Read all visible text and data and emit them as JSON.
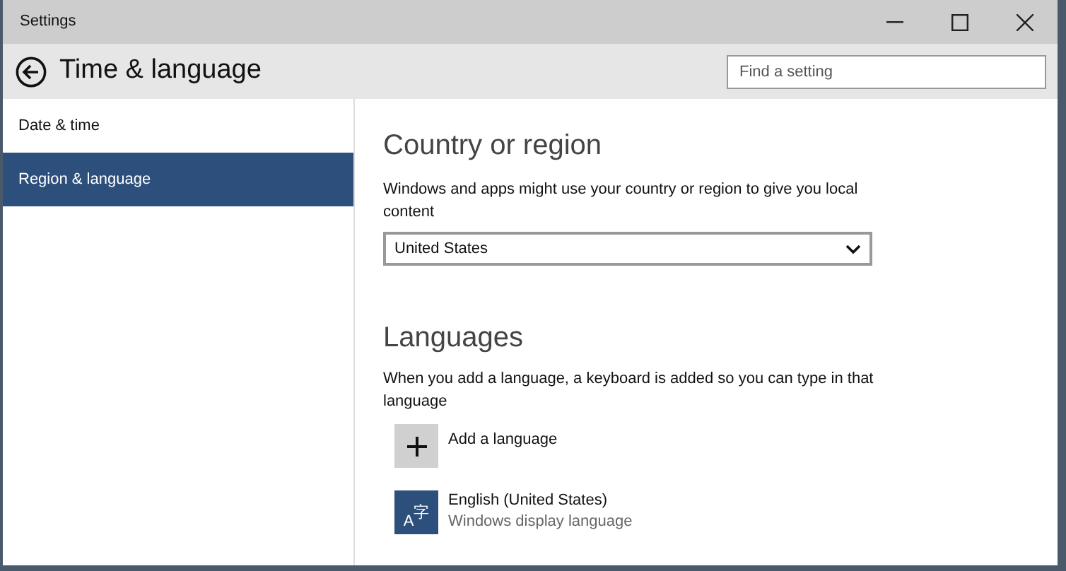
{
  "window": {
    "title": "Settings"
  },
  "header": {
    "title": "Time & language",
    "search": {
      "placeholder": "Find a setting"
    }
  },
  "sidebar": {
    "items": [
      {
        "label": "Date & time",
        "selected": false
      },
      {
        "label": "Region & language",
        "selected": true
      }
    ]
  },
  "country_section": {
    "heading": "Country or region",
    "description": "Windows and apps might use your country or region to give you local content",
    "dropdown": {
      "value": "United States"
    }
  },
  "languages_section": {
    "heading": "Languages",
    "description": "When you add a language, a keyboard is added so you can type in that language",
    "items": [
      {
        "kind": "add",
        "label": "Add a language"
      },
      {
        "kind": "language",
        "label": "English (United States)",
        "sublabel": "Windows display language",
        "icon_letter": "A",
        "icon_glyph": "字"
      }
    ]
  }
}
